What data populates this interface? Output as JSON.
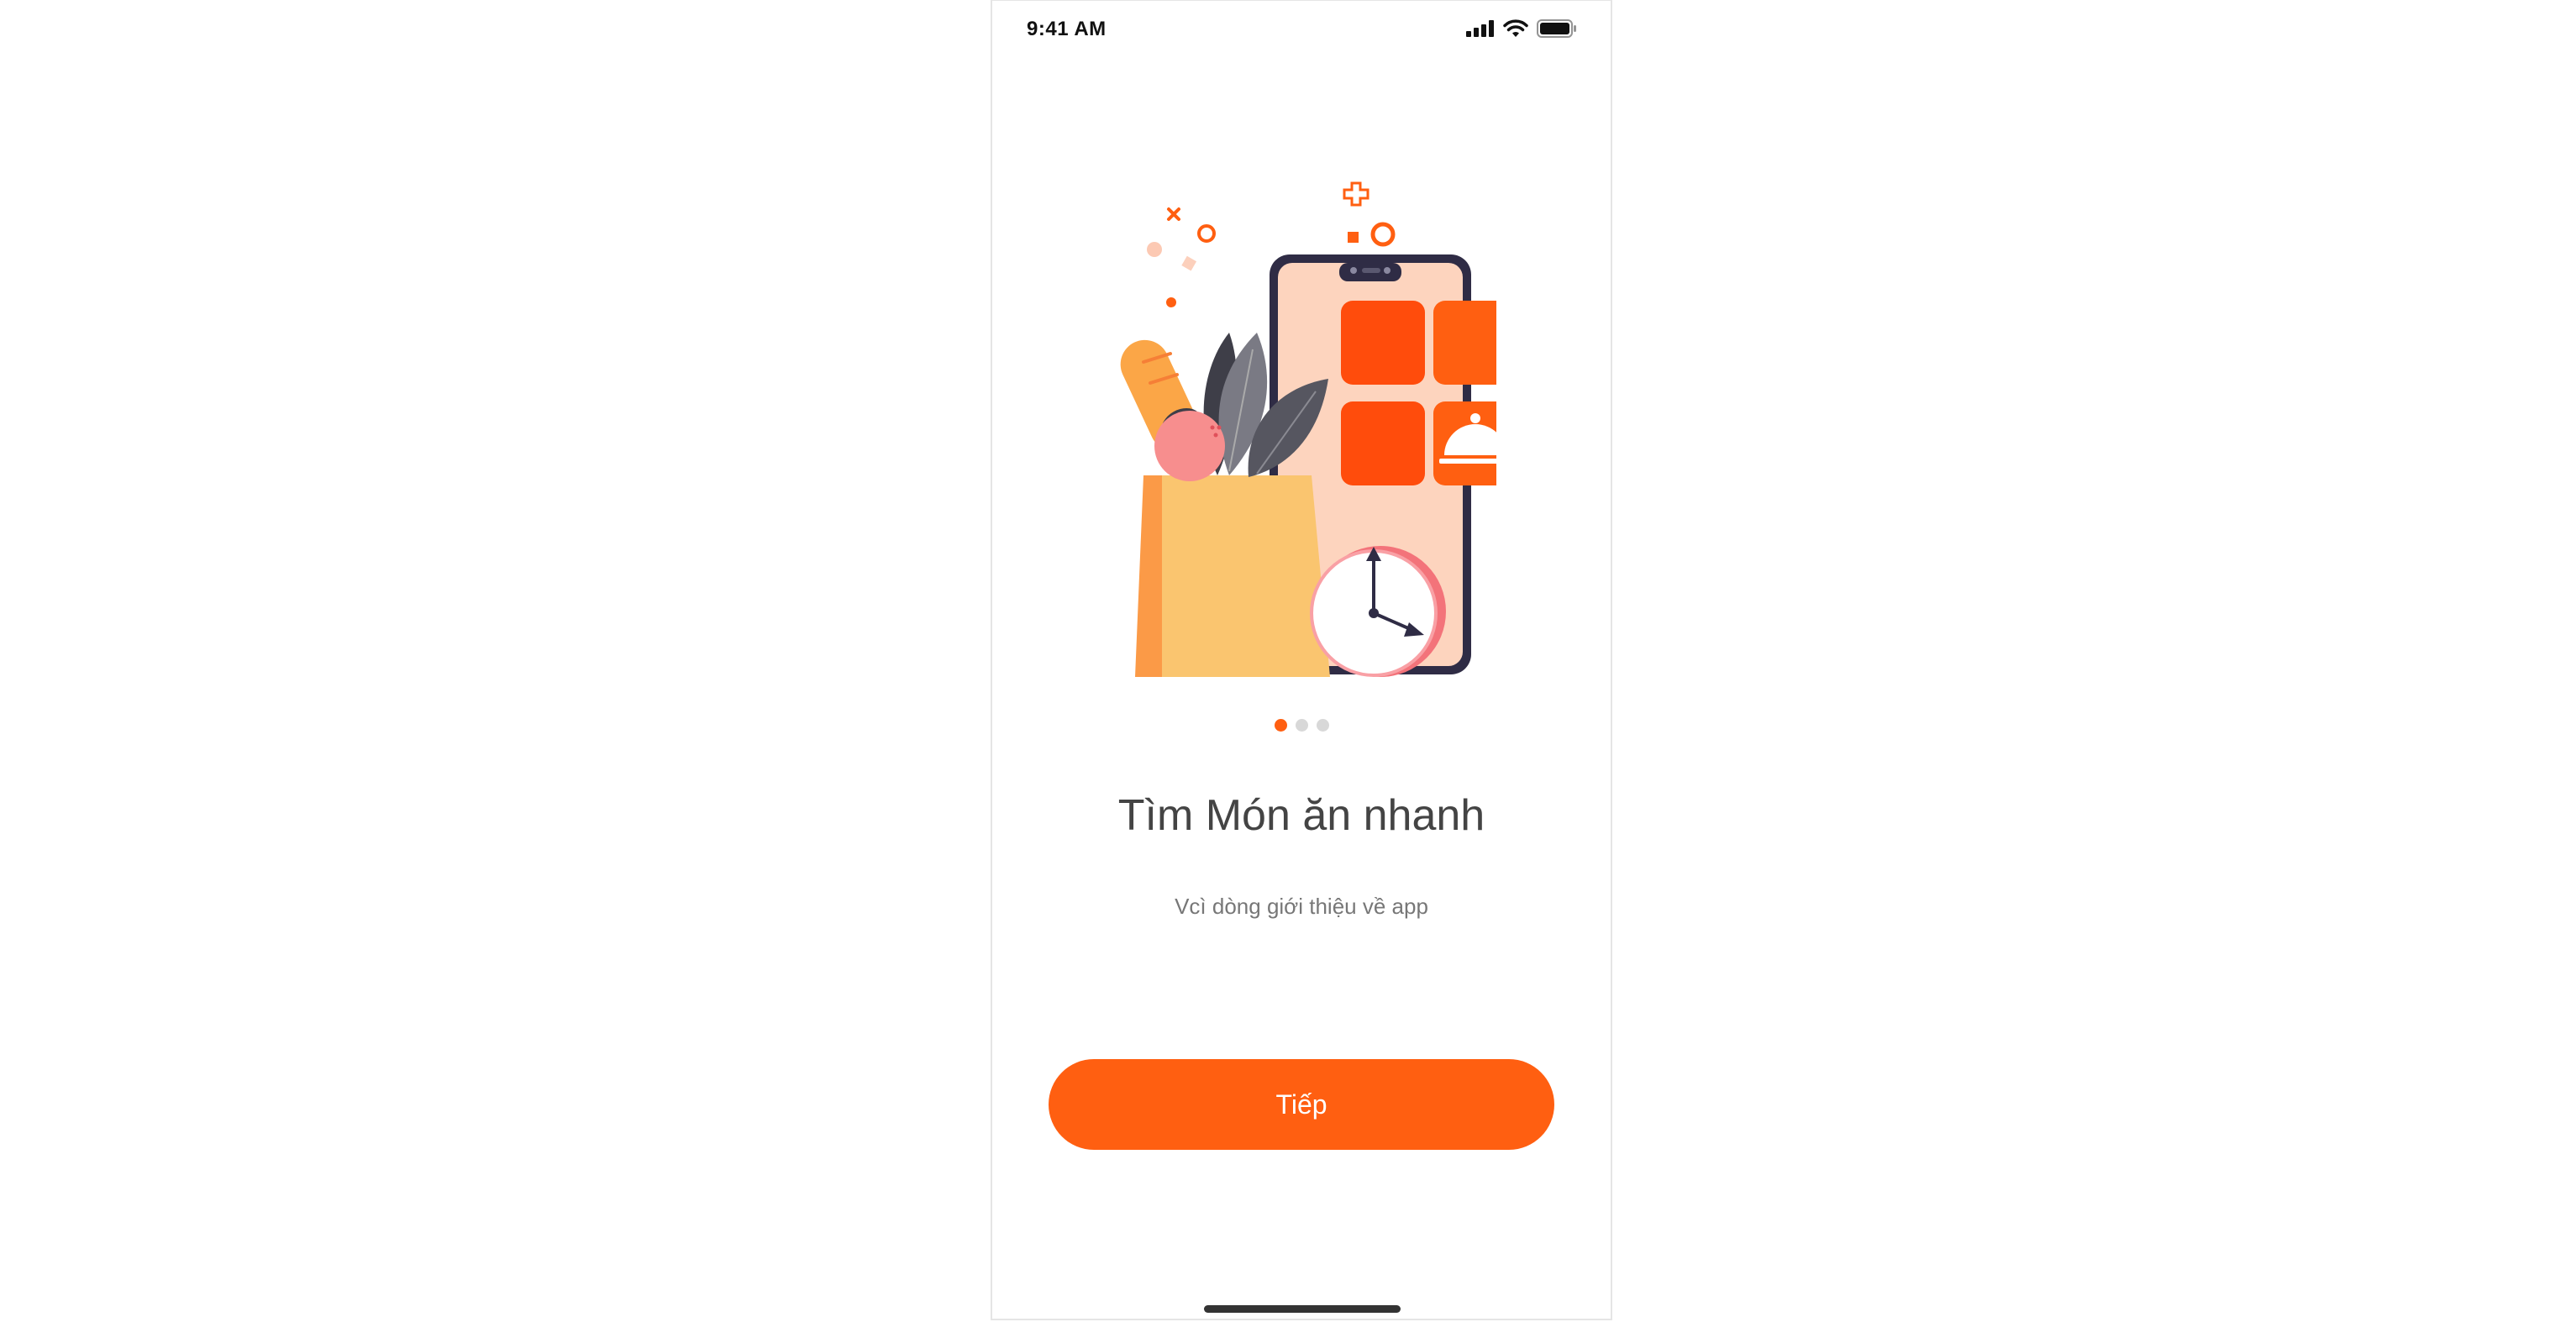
{
  "status_bar": {
    "time": "9:41 AM",
    "icons": [
      "cellular-signal-icon",
      "wifi-icon",
      "battery-icon"
    ]
  },
  "illustration": {
    "name": "grocery-bag-phone-illustration",
    "elements": [
      "grocery-bag",
      "bread",
      "apple",
      "leaves",
      "phone-with-app-tiles",
      "cloche-icon",
      "clock"
    ]
  },
  "onboarding": {
    "pagination": {
      "total": 3,
      "active_index": 0
    },
    "title": "Tìm Món ăn nhanh",
    "subtitle": "Vcì dòng giới thiệu về app",
    "next_button_label": "Tiếp"
  },
  "colors": {
    "accent": "#ff5f11",
    "inactive_dot": "#d8d8d8",
    "title_text": "#444444",
    "subtitle_text": "#777777"
  }
}
